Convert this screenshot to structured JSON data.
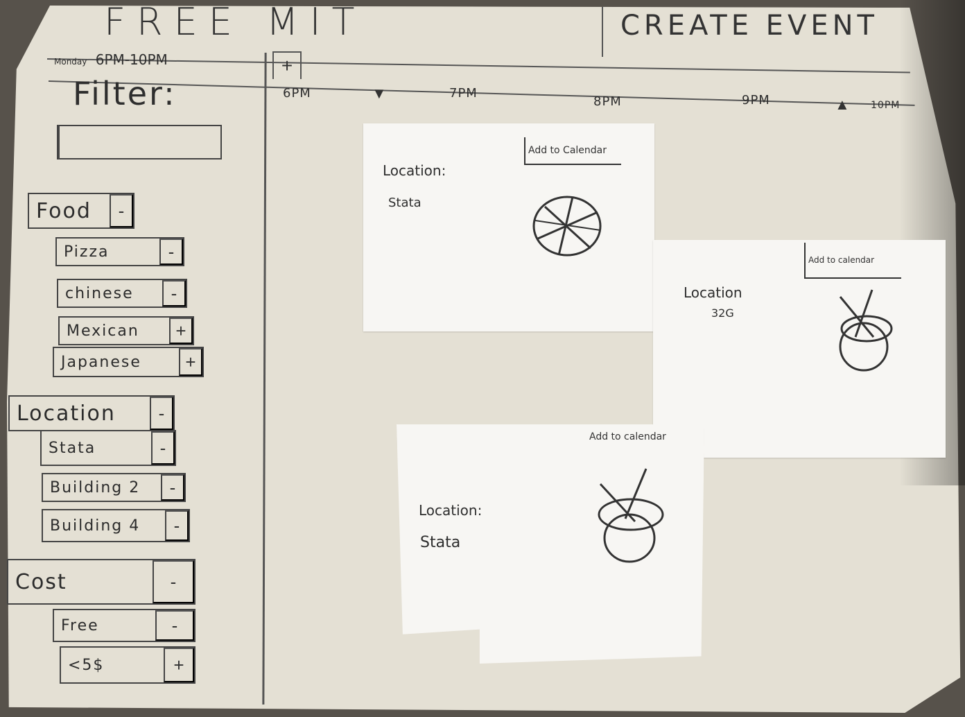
{
  "header": {
    "app_title": "FREE MIT",
    "create_event": "CREATE EVENT"
  },
  "date_bar": {
    "weekday": "Monday",
    "range": "6PM-10PM",
    "add_button": "+"
  },
  "filter": {
    "title": "Filter:",
    "search_value": "",
    "groups": [
      {
        "label": "Food",
        "toggle": "-",
        "items": [
          {
            "label": "Pizza",
            "toggle": "-"
          },
          {
            "label": "chinese",
            "toggle": "-"
          },
          {
            "label": "Mexican",
            "toggle": "+"
          },
          {
            "label": "Japanese",
            "toggle": "+"
          }
        ]
      },
      {
        "label": "Location",
        "toggle": "-",
        "items": [
          {
            "label": "Stata",
            "toggle": "-"
          },
          {
            "label": "Building 2",
            "toggle": "-"
          },
          {
            "label": "Building 4",
            "toggle": "-"
          }
        ]
      },
      {
        "label": "Cost",
        "toggle": "-",
        "items": [
          {
            "label": "Free",
            "toggle": "-"
          },
          {
            "label": "<5$",
            "toggle": "+"
          }
        ]
      }
    ]
  },
  "timeline": {
    "ticks": [
      "6PM",
      "7PM",
      "8PM",
      "9PM",
      "10PM"
    ],
    "scroll_left": "▼",
    "scroll_right": "▲"
  },
  "events": [
    {
      "location_label": "Location:",
      "location": "Stata",
      "add_to_calendar": "Add to Calendar",
      "icon": "pizza-icon"
    },
    {
      "location_label": "Location",
      "location": "32G",
      "add_to_calendar": "Add to calendar",
      "icon": "bowl-chopsticks-icon"
    },
    {
      "location_label": "Location:",
      "location": "Stata",
      "add_to_calendar": "Add to calendar",
      "icon": "bowl-chopsticks-icon"
    }
  ]
}
